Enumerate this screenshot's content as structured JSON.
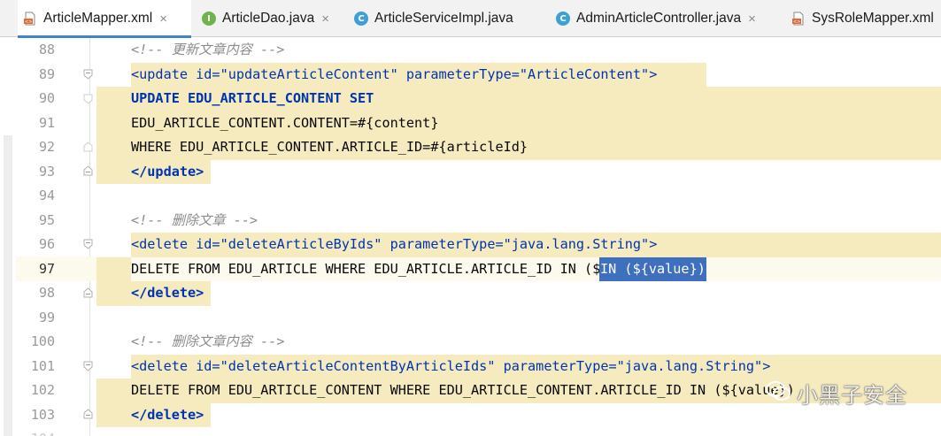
{
  "tabs": [
    {
      "label": "ArticleMapper.xml",
      "icon": "xml-file-icon",
      "active": true,
      "closable": true
    },
    {
      "label": "ArticleDao.java",
      "icon": "interface-icon",
      "active": false,
      "closable": true
    },
    {
      "label": "ArticleServiceImpl.java",
      "icon": "class-icon",
      "active": false,
      "closable": false
    },
    {
      "label": "AdminArticleController.java",
      "icon": "class-icon",
      "active": false,
      "closable": true
    },
    {
      "label": "SysRoleMapper.xml",
      "icon": "xml-file-icon",
      "active": false,
      "closable": false
    }
  ],
  "tab_close_glyph": "×",
  "icon_letters": {
    "interface": "I",
    "class": "C"
  },
  "colors": {
    "accent_tab": "#4083c9",
    "highlight": "#f5ebbf",
    "selection": "#3f6fbf",
    "xml_tag": "#0033b3",
    "xml_string": "#067d17",
    "comment": "#8c8c8c",
    "interface_icon": "#6fb34f",
    "class_icon": "#3fa0d6"
  },
  "editor": {
    "lines": [
      {
        "num": "88",
        "text": "<!-- 更新文章内容 -->"
      },
      {
        "num": "89",
        "text": "<update id=\"updateArticleContent\" parameterType=\"ArticleContent\">"
      },
      {
        "num": "90",
        "text": "UPDATE EDU_ARTICLE_CONTENT SET"
      },
      {
        "num": "91",
        "text": "EDU_ARTICLE_CONTENT.CONTENT=#{content}"
      },
      {
        "num": "92",
        "text": "WHERE EDU_ARTICLE_CONTENT.ARTICLE_ID=#{articleId}"
      },
      {
        "num": "93",
        "text": "</update>"
      },
      {
        "num": "94",
        "text": ""
      },
      {
        "num": "95",
        "text": "<!-- 删除文章 -->"
      },
      {
        "num": "96",
        "text": "<delete id=\"deleteArticleByIds\" parameterType=\"java.lang.String\">"
      },
      {
        "num": "97",
        "text": "DELETE FROM EDU_ARTICLE WHERE EDU_ARTICLE.ARTICLE_ID IN (${value})",
        "selected_text": "IN (${value})",
        "current": true
      },
      {
        "num": "98",
        "text": "</delete>"
      },
      {
        "num": "99",
        "text": ""
      },
      {
        "num": "100",
        "text": "<!-- 删除文章内容 -->"
      },
      {
        "num": "101",
        "text": "<delete id=\"deleteArticleContentByArticleIds\" parameterType=\"java.lang.String\">"
      },
      {
        "num": "102",
        "text": "DELETE FROM EDU_ARTICLE_CONTENT WHERE EDU_ARTICLE_CONTENT.ARTICLE_ID IN (${value})"
      },
      {
        "num": "103",
        "text": "</delete>"
      }
    ]
  },
  "watermark": {
    "text": "小黑子安全",
    "icon": "wechat-icon"
  }
}
